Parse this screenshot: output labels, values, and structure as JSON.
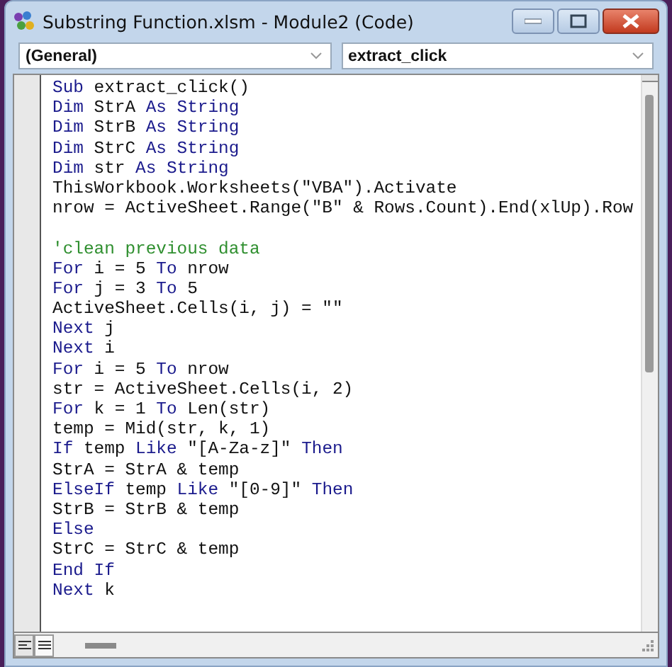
{
  "window": {
    "title": "Substring Function.xlsm - Module2 (Code)"
  },
  "object_dropdown": {
    "value": "(General)"
  },
  "procedure_dropdown": {
    "value": "extract_click"
  },
  "code_lines": [
    {
      "kind": "code",
      "tokens": [
        {
          "kind": "keyword",
          "text": "Sub"
        },
        {
          "kind": "plain",
          "text": " extract_click()"
        }
      ]
    },
    {
      "kind": "code",
      "tokens": [
        {
          "kind": "keyword",
          "text": "Dim"
        },
        {
          "kind": "plain",
          "text": " StrA "
        },
        {
          "kind": "keyword",
          "text": "As String"
        }
      ]
    },
    {
      "kind": "code",
      "tokens": [
        {
          "kind": "keyword",
          "text": "Dim"
        },
        {
          "kind": "plain",
          "text": " StrB "
        },
        {
          "kind": "keyword",
          "text": "As String"
        }
      ]
    },
    {
      "kind": "code",
      "tokens": [
        {
          "kind": "keyword",
          "text": "Dim"
        },
        {
          "kind": "plain",
          "text": " StrC "
        },
        {
          "kind": "keyword",
          "text": "As String"
        }
      ]
    },
    {
      "kind": "code",
      "tokens": [
        {
          "kind": "keyword",
          "text": "Dim"
        },
        {
          "kind": "plain",
          "text": " str "
        },
        {
          "kind": "keyword",
          "text": "As String"
        }
      ]
    },
    {
      "kind": "code",
      "tokens": [
        {
          "kind": "plain",
          "text": "ThisWorkbook.Worksheets(\"VBA\").Activate"
        }
      ]
    },
    {
      "kind": "code",
      "tokens": [
        {
          "kind": "plain",
          "text": "nrow = ActiveSheet.Range(\"B\" & Rows.Count).End(xlUp).Row"
        }
      ]
    },
    {
      "kind": "blank"
    },
    {
      "kind": "code",
      "tokens": [
        {
          "kind": "comment",
          "text": "'clean previous data"
        }
      ]
    },
    {
      "kind": "code",
      "tokens": [
        {
          "kind": "keyword",
          "text": "For"
        },
        {
          "kind": "plain",
          "text": " i = 5 "
        },
        {
          "kind": "keyword",
          "text": "To"
        },
        {
          "kind": "plain",
          "text": " nrow"
        }
      ]
    },
    {
      "kind": "code",
      "tokens": [
        {
          "kind": "keyword",
          "text": "For"
        },
        {
          "kind": "plain",
          "text": " j = 3 "
        },
        {
          "kind": "keyword",
          "text": "To"
        },
        {
          "kind": "plain",
          "text": " 5"
        }
      ]
    },
    {
      "kind": "code",
      "tokens": [
        {
          "kind": "plain",
          "text": "ActiveSheet.Cells(i, j) = \"\""
        }
      ]
    },
    {
      "kind": "code",
      "tokens": [
        {
          "kind": "keyword",
          "text": "Next"
        },
        {
          "kind": "plain",
          "text": " j"
        }
      ]
    },
    {
      "kind": "code",
      "tokens": [
        {
          "kind": "keyword",
          "text": "Next"
        },
        {
          "kind": "plain",
          "text": " i"
        }
      ]
    },
    {
      "kind": "code",
      "tokens": [
        {
          "kind": "keyword",
          "text": "For"
        },
        {
          "kind": "plain",
          "text": " i = 5 "
        },
        {
          "kind": "keyword",
          "text": "To"
        },
        {
          "kind": "plain",
          "text": " nrow"
        }
      ]
    },
    {
      "kind": "code",
      "tokens": [
        {
          "kind": "plain",
          "text": "str = ActiveSheet.Cells(i, 2)"
        }
      ]
    },
    {
      "kind": "code",
      "tokens": [
        {
          "kind": "keyword",
          "text": "For"
        },
        {
          "kind": "plain",
          "text": " k = 1 "
        },
        {
          "kind": "keyword",
          "text": "To"
        },
        {
          "kind": "plain",
          "text": " Len(str)"
        }
      ]
    },
    {
      "kind": "code",
      "tokens": [
        {
          "kind": "plain",
          "text": "temp = Mid(str, k, 1)"
        }
      ]
    },
    {
      "kind": "code",
      "tokens": [
        {
          "kind": "keyword",
          "text": "If"
        },
        {
          "kind": "plain",
          "text": " temp "
        },
        {
          "kind": "keyword",
          "text": "Like"
        },
        {
          "kind": "plain",
          "text": " \"[A-Za-z]\" "
        },
        {
          "kind": "keyword",
          "text": "Then"
        }
      ]
    },
    {
      "kind": "code",
      "tokens": [
        {
          "kind": "plain",
          "text": "StrA = StrA & temp"
        }
      ]
    },
    {
      "kind": "code",
      "tokens": [
        {
          "kind": "keyword",
          "text": "ElseIf"
        },
        {
          "kind": "plain",
          "text": " temp "
        },
        {
          "kind": "keyword",
          "text": "Like"
        },
        {
          "kind": "plain",
          "text": " \"[0-9]\" "
        },
        {
          "kind": "keyword",
          "text": "Then"
        }
      ]
    },
    {
      "kind": "code",
      "tokens": [
        {
          "kind": "plain",
          "text": "StrB = StrB & temp"
        }
      ]
    },
    {
      "kind": "code",
      "tokens": [
        {
          "kind": "keyword",
          "text": "Else"
        }
      ]
    },
    {
      "kind": "code",
      "tokens": [
        {
          "kind": "plain",
          "text": "StrC = StrC & temp"
        }
      ]
    },
    {
      "kind": "code",
      "tokens": [
        {
          "kind": "keyword",
          "text": "End If"
        }
      ]
    },
    {
      "kind": "code",
      "tokens": [
        {
          "kind": "keyword",
          "text": "Next"
        },
        {
          "kind": "plain",
          "text": " k"
        }
      ]
    }
  ]
}
